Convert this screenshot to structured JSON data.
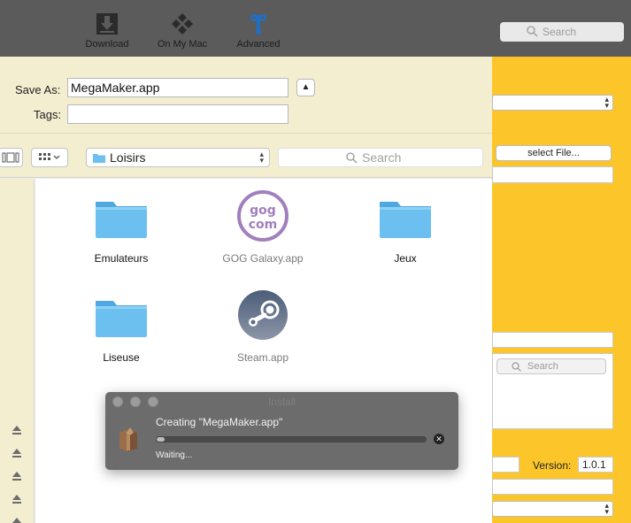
{
  "toolbar": {
    "download_label": "Download",
    "on_my_mac_label": "On My Mac",
    "advanced_label": "Advanced",
    "search_placeholder": "Search"
  },
  "save_sheet": {
    "save_as_label": "Save As:",
    "save_as_value": "MegaMaker.app",
    "tags_label": "Tags:",
    "tags_value": "",
    "location": "Loisirs",
    "search_placeholder": "Search",
    "files": [
      {
        "name": "Emulateurs",
        "kind": "folder",
        "enabled": true
      },
      {
        "name": "GOG Galaxy.app",
        "kind": "gog-app",
        "enabled": false
      },
      {
        "name": "Jeux",
        "kind": "folder",
        "enabled": true
      },
      {
        "name": "Liseuse",
        "kind": "folder",
        "enabled": true
      },
      {
        "name": "Steam.app",
        "kind": "steam-app",
        "enabled": false
      }
    ],
    "gog_logo_text": {
      "line1": "gog",
      "line2": "com"
    }
  },
  "background_app": {
    "select_file_label": "select File...",
    "search_placeholder": "Search",
    "version_label": "Version:",
    "version_value": "1.0.1"
  },
  "install_dialog": {
    "title": "Install",
    "status": "Creating \"MegaMaker.app\"",
    "substatus": "Waiting...",
    "progress_percent": 3
  },
  "colors": {
    "toolbar": "#5b5b5b",
    "accent_yellow": "#fcc62b",
    "sheet_cream": "#f3eed0",
    "folder_blue": "#6cc0ef"
  }
}
